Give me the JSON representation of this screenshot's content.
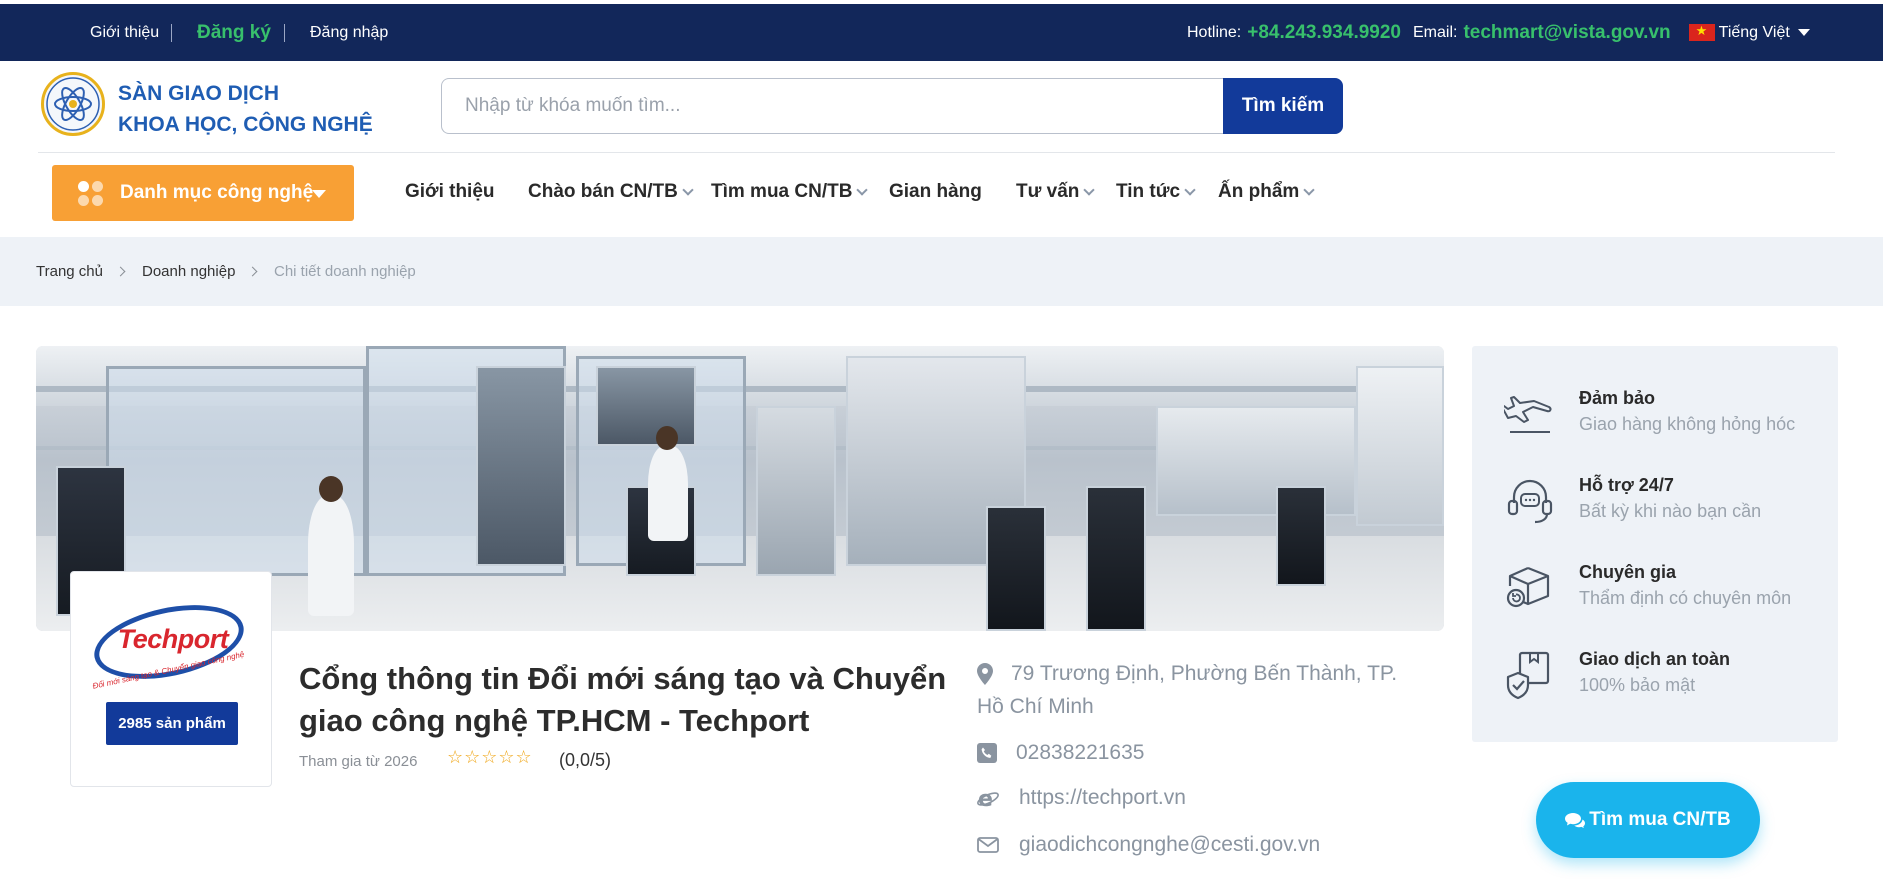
{
  "topbar": {
    "about": "Giới thiệu",
    "register": "Đăng ký",
    "login": "Đăng nhập",
    "hotline_label": "Hotline:",
    "hotline": "+84.243.934.9920",
    "email_label": "Email:",
    "email": "techmart@vista.gov.vn",
    "language": "Tiếng Việt"
  },
  "header": {
    "brand_line1": "SÀN GIAO DỊCH",
    "brand_line2": "KHOA HỌC, CÔNG NGHỆ",
    "search_placeholder": "Nhập từ khóa muốn tìm...",
    "search_button": "Tìm kiếm"
  },
  "nav": {
    "category_button": "Danh mục công nghệ",
    "items": [
      {
        "label": "Giới thiệu",
        "dropdown": false
      },
      {
        "label": "Chào bán CN/TB",
        "dropdown": true
      },
      {
        "label": "Tìm mua CN/TB",
        "dropdown": true
      },
      {
        "label": "Gian hàng",
        "dropdown": false
      },
      {
        "label": "Tư vấn",
        "dropdown": true
      },
      {
        "label": "Tin tức",
        "dropdown": true
      },
      {
        "label": "Ấn phẩm",
        "dropdown": true
      }
    ]
  },
  "breadcrumb": [
    "Trang chủ",
    "Doanh nghiệp",
    "Chi tiết doanh nghiệp"
  ],
  "company": {
    "logo_word": "Techport",
    "logo_tagline": "Đổi mới sáng tạo & Chuyển giao công nghệ",
    "products_badge": "2985 sản phẩm",
    "title": "Cổng thông tin Đổi mới sáng tạo và Chuyển giao công nghệ TP.HCM - Techport",
    "joined": "Tham gia từ 2026",
    "stars": "☆☆☆☆☆",
    "rating": "(0,0/5)",
    "address": "79 Trương Định, Phường Bến Thành, TP. Hồ Chí Minh",
    "phone": "02838221635",
    "website": "https://techport.vn",
    "email": "giaodichcongnghe@cesti.gov.vn"
  },
  "sidebar": {
    "items": [
      {
        "title": "Đảm bảo",
        "subtitle": "Giao hàng không hỏng hóc",
        "icon": "airplane-icon"
      },
      {
        "title": "Hỗ trợ 24/7",
        "subtitle": "Bất kỳ khi nào bạn cần",
        "icon": "headset-icon"
      },
      {
        "title": "Chuyên gia",
        "subtitle": "Thẩm định có chuyên môn",
        "icon": "box-return-icon"
      },
      {
        "title": "Giao dịch an toàn",
        "subtitle": "100% bảo mật",
        "icon": "shield-check-icon"
      }
    ]
  },
  "cta": {
    "buy_button": "Tìm mua CN/TB",
    "icon": "chat-icon"
  },
  "colors": {
    "topbar": "#12275a",
    "accent_green": "#38c06c",
    "brand_blue": "#123a9a",
    "orange": "#f8a035",
    "cyan": "#1ab4ec"
  }
}
